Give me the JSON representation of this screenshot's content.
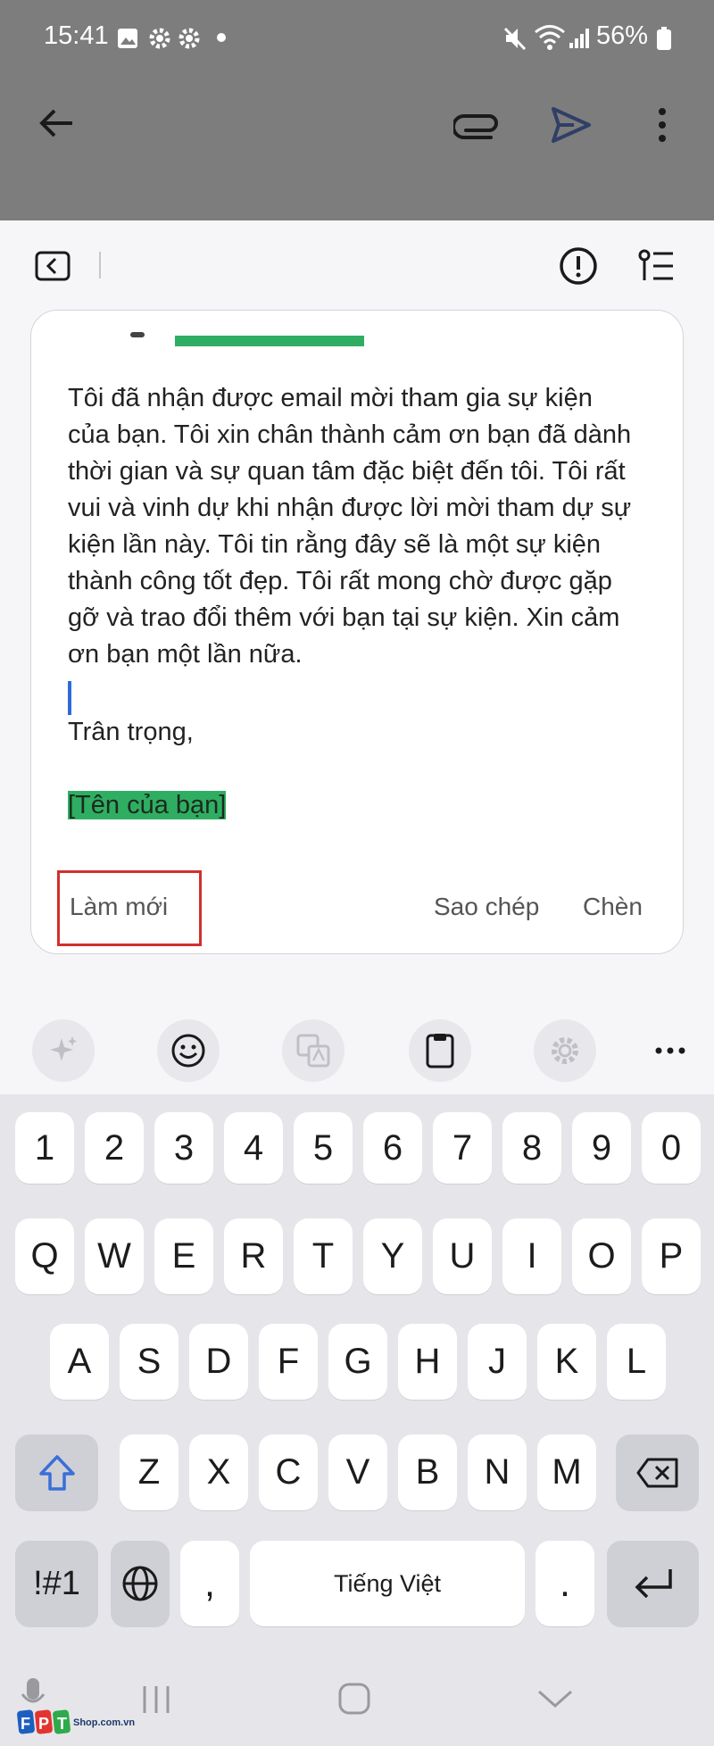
{
  "status": {
    "time": "15:41",
    "battery": "56%"
  },
  "email": {
    "body": "Tôi đã nhận được email mời tham gia sự kiện của bạn. Tôi xin chân thành cảm ơn bạn đã dành thời gian và sự quan tâm đặc biệt đến tôi. Tôi rất vui và vinh dự khi nhận được lời mời tham dự sự kiện lần này. Tôi tin rằng đây sẽ là một sự kiện thành công tốt đẹp. Tôi rất mong chờ được gặp gỡ và trao đổi thêm với bạn tại sự kiện.  Xin cảm ơn bạn một lần nữa.",
    "closing": "Trân trọng,",
    "name_placeholder": "[Tên của bạn]"
  },
  "actions": {
    "refresh": "Làm mới",
    "copy": "Sao chép",
    "insert": "Chèn"
  },
  "keyboard": {
    "row_numbers": [
      "1",
      "2",
      "3",
      "4",
      "5",
      "6",
      "7",
      "8",
      "9",
      "0"
    ],
    "row1": [
      "Q",
      "W",
      "E",
      "R",
      "T",
      "Y",
      "U",
      "I",
      "O",
      "P"
    ],
    "row2": [
      "A",
      "S",
      "D",
      "F",
      "G",
      "H",
      "J",
      "K",
      "L"
    ],
    "row3": [
      "Z",
      "X",
      "C",
      "V",
      "B",
      "N",
      "M"
    ],
    "symbols": "!#1",
    "comma": ",",
    "space": "Tiếng Việt",
    "period": "."
  },
  "watermark": {
    "brand": "FPT",
    "site": "Shop.com.vn"
  },
  "colors": {
    "highlight": "#2fae63",
    "cursor": "#2d6bd9",
    "annotation": "#d1302d",
    "send": "#2f3f66"
  }
}
